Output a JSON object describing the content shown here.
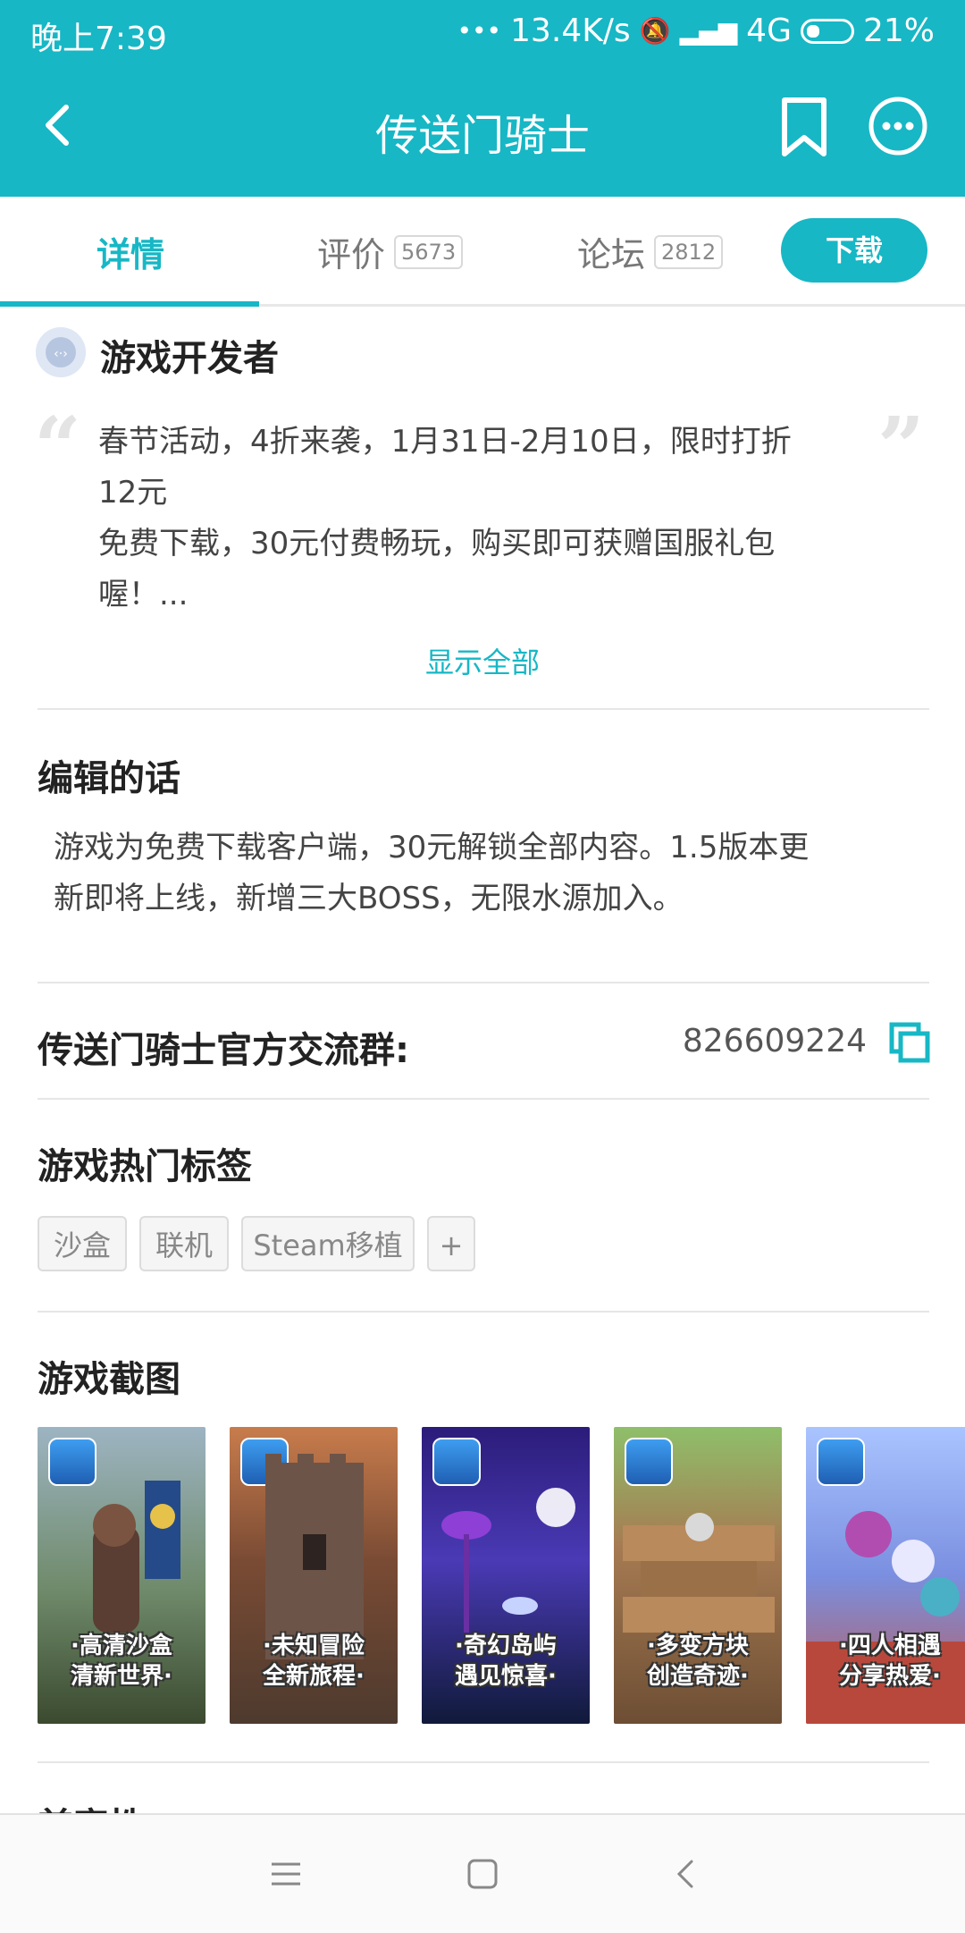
{
  "status_bar": {
    "time": "晚上7:39",
    "speed": "13.4K/s",
    "network": "4G",
    "battery": "21%"
  },
  "header": {
    "title": "传送门骑士",
    "back_icon": "chevron-left-icon",
    "bookmark_icon": "bookmark-icon",
    "more_icon": "more-icon"
  },
  "tabs": [
    {
      "label": "详情",
      "count": ""
    },
    {
      "label": "评价",
      "count": "5673"
    },
    {
      "label": "论坛",
      "count": "2812"
    }
  ],
  "download_label": "下载",
  "developer": {
    "heading": "游戏开发者",
    "lines": [
      "春节活动，4折来袭，1月31日-2月10日，限时打折",
      "12元",
      "免费下载，30元付费畅玩，购买即可获赠国服礼包",
      "喔！..."
    ],
    "show_all": "显示全部"
  },
  "editor": {
    "heading": "编辑的话",
    "lines": [
      "游戏为免费下载客户端，30元解锁全部内容。1.5版本更",
      "新即将上线，新增三大BOSS，无限水源加入。"
    ]
  },
  "group": {
    "label": "传送门骑士官方交流群:",
    "value": "826609224"
  },
  "tags": {
    "heading": "游戏热门标签",
    "items": [
      "沙盒",
      "联机",
      "Steam移植",
      "+"
    ]
  },
  "screenshots": {
    "heading": "游戏截图",
    "items": [
      {
        "line1": "·高清沙盒",
        "line2": "清新世界·"
      },
      {
        "line1": "·未知冒险",
        "line2": "全新旅程·"
      },
      {
        "line1": "·奇幻岛屿",
        "line2": "遇见惊喜·"
      },
      {
        "line1": "·多变方块",
        "line2": "创造奇迹·"
      },
      {
        "line1": "·四人相遇",
        "line2": "分享热爱·"
      }
    ]
  },
  "next_heading": "兼容性",
  "colors": {
    "accent": "#17b7c5"
  }
}
